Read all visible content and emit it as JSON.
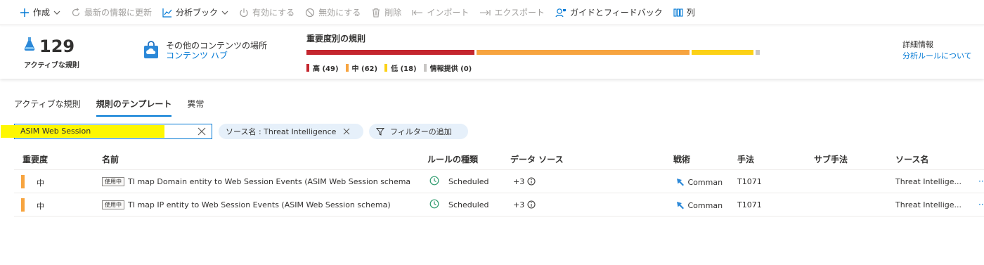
{
  "toolbar": {
    "create": "作成",
    "refresh": "最新の情報に更新",
    "workbook": "分析ブック",
    "enable": "有効にする",
    "disable": "無効にする",
    "delete": "削除",
    "import": "インポート",
    "export": "エクスポート",
    "feedback": "ガイドとフィードバック",
    "columns": "列"
  },
  "summary": {
    "active_count": "129",
    "active_label": "アクティブな規則",
    "hub_line1": "その他のコンテンツの場所",
    "hub_link": "コンテンツ ハブ",
    "severity_title": "重要度別の規則",
    "severity": [
      {
        "label": "高",
        "count": "(49)",
        "value": 49,
        "color": "#c4262e"
      },
      {
        "label": "中",
        "count": "(62)",
        "value": 62,
        "color": "#f7a43f"
      },
      {
        "label": "低",
        "count": "(18)",
        "value": 18,
        "color": "#fcd116"
      },
      {
        "label": "情報提供",
        "count": "(0)",
        "value": 0,
        "color": "#c8c6c4"
      }
    ],
    "info_title": "詳細情報",
    "info_link": "分析ルールについて"
  },
  "tabs": [
    {
      "label": "アクティブな規則",
      "active": false
    },
    {
      "label": "規則のテンプレート",
      "active": true
    },
    {
      "label": "異常",
      "active": false
    }
  ],
  "filters": {
    "search_value": "ASIM Web Session",
    "chip_source": "ソース名 : Threat Intelligence",
    "add_filter": "フィルターの追加"
  },
  "table": {
    "headers": {
      "severity": "重要度",
      "name": "名前",
      "rule_type": "ルールの種類",
      "data_source": "データ ソース",
      "tactics": "戦術",
      "techniques": "手法",
      "subtechniques": "サブ手法",
      "source_name": "ソース名"
    },
    "rows": [
      {
        "severity": "中",
        "badge": "使用中",
        "name": "TI map Domain entity to Web Session Events (ASIM Web Session schema",
        "rule_type": "Scheduled",
        "data_source": "+3",
        "tactic": "Comman",
        "technique": "T1071",
        "source_name": "Threat Intellige...",
        "more": "···"
      },
      {
        "severity": "中",
        "badge": "使用中",
        "name": "TI map IP entity to Web Session Events (ASIM Web Session schema)",
        "rule_type": "Scheduled",
        "data_source": "+3",
        "tactic": "Comman",
        "technique": "T1071",
        "source_name": "Threat Intellige...",
        "more": "···"
      }
    ]
  },
  "colors": {
    "accent": "#0078d4",
    "highlight": "#fef701",
    "severity_medium": "#f7a43f"
  }
}
